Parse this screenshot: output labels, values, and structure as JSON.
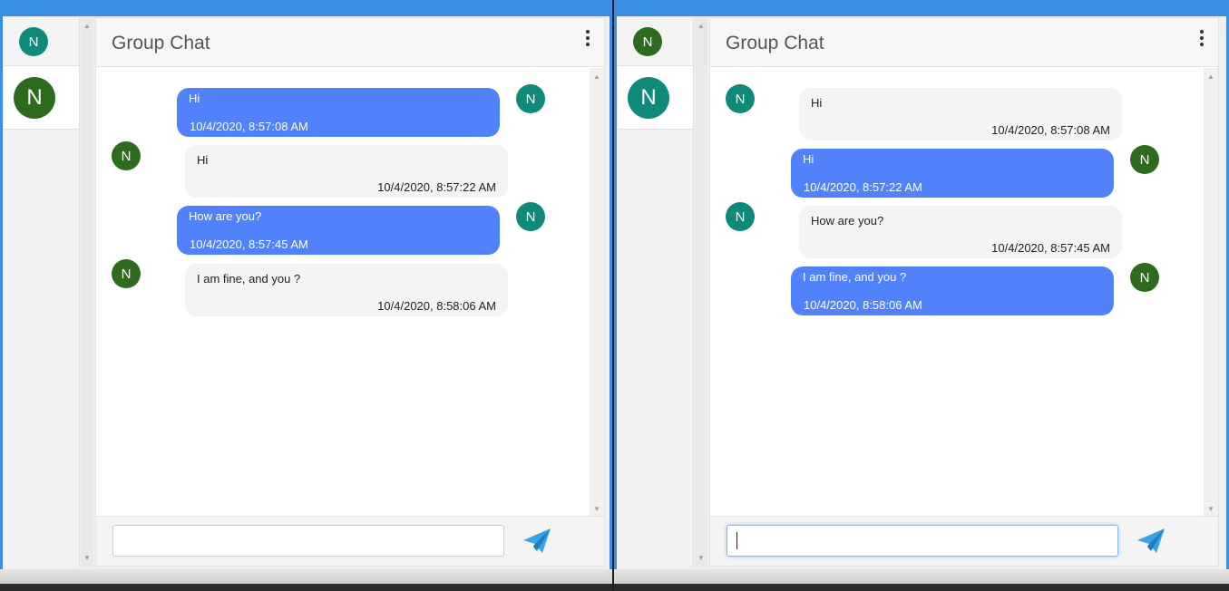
{
  "colors": {
    "mine_bubble": "#5182fb",
    "other_bubble": "#f4f4f4",
    "avatar_teal": "#0f8a78",
    "avatar_green": "#2f6b1f",
    "send_icon": "#3aa3e8"
  },
  "icons": {
    "menu": "kebab-menu-icon",
    "send": "paper-plane-icon",
    "scroll_up": "chevron-up-icon",
    "scroll_down": "chevron-down-icon"
  },
  "left_window": {
    "sidebar": {
      "top_avatar": "N",
      "items": [
        {
          "avatar": "N"
        }
      ]
    },
    "header": {
      "title": "Group Chat"
    },
    "messages": [
      {
        "side": "mine",
        "text": "Hi",
        "time": "10/4/2020, 8:57:08 AM",
        "avatar": "N"
      },
      {
        "side": "other",
        "text": "Hi",
        "time": "10/4/2020, 8:57:22 AM",
        "avatar": "N"
      },
      {
        "side": "mine",
        "text": "How are you?",
        "time": "10/4/2020, 8:57:45 AM",
        "avatar": "N"
      },
      {
        "side": "other",
        "text": "I am fine, and you ?",
        "time": "10/4/2020, 8:58:06 AM",
        "avatar": "N"
      }
    ],
    "input": {
      "value": "",
      "placeholder": ""
    }
  },
  "right_window": {
    "sidebar": {
      "top_avatar": "N",
      "items": [
        {
          "avatar": "N"
        }
      ]
    },
    "header": {
      "title": "Group Chat"
    },
    "messages": [
      {
        "side": "other",
        "text": "Hi",
        "time": "10/4/2020, 8:57:08 AM",
        "avatar": "N"
      },
      {
        "side": "mine",
        "text": "Hi",
        "time": "10/4/2020, 8:57:22 AM",
        "avatar": "N"
      },
      {
        "side": "other",
        "text": "How are you?",
        "time": "10/4/2020, 8:57:45 AM",
        "avatar": "N"
      },
      {
        "side": "mine",
        "text": "I am fine, and you ?",
        "time": "10/4/2020, 8:58:06 AM",
        "avatar": "N"
      }
    ],
    "input": {
      "value": "",
      "placeholder": ""
    }
  }
}
